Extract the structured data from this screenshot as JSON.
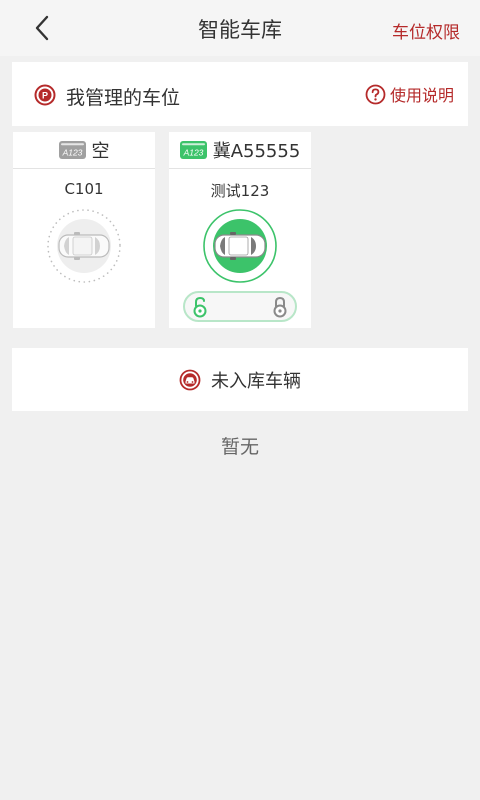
{
  "nav": {
    "title": "智能车库",
    "right_label": "车位权限"
  },
  "section": {
    "title": "我管理的车位",
    "help_label": "使用说明"
  },
  "slots": [
    {
      "plate": "空",
      "name": "C101",
      "status": "empty",
      "plate_badge": "A123",
      "plate_badge_color": "#a0a0a0"
    },
    {
      "plate": "冀A55555",
      "name": "测试123",
      "status": "occupied",
      "plate_badge": "A123",
      "plate_badge_color": "#3cc36a"
    }
  ],
  "unentered": {
    "title": "未入库车辆",
    "empty_text": "暂无"
  },
  "colors": {
    "accent_red": "#b52a2a",
    "green": "#3cc36a",
    "background": "#f0f0f0"
  }
}
